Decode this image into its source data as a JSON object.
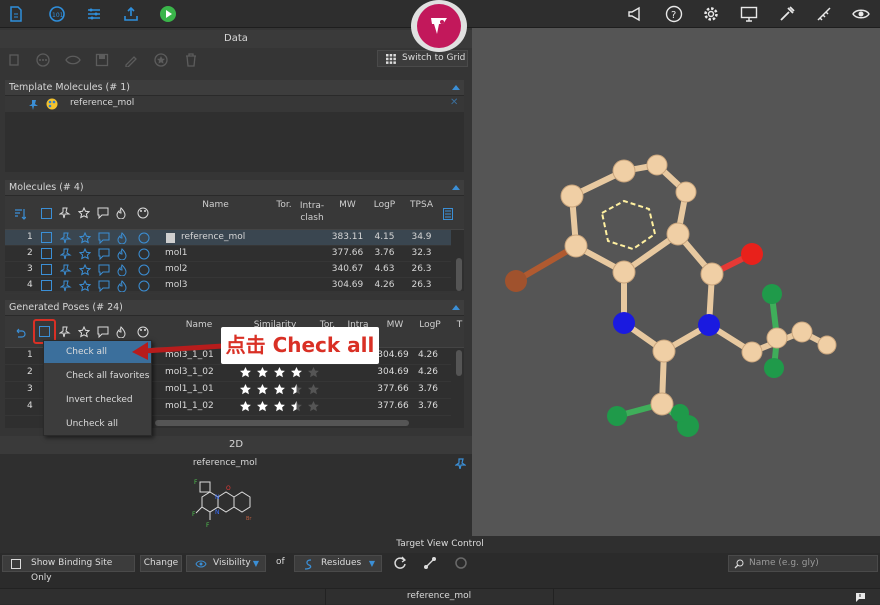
{
  "data_header": "Data",
  "switch_to_grid": "Switch to Grid",
  "template": {
    "title": "Template Molecules  (# 1)",
    "item": "reference_mol"
  },
  "molecules": {
    "title": "Molecules  (# 4)",
    "columns": [
      "Name",
      "Tor.",
      "Intra-clash",
      "MW",
      "LogP",
      "TPSA"
    ],
    "rows": [
      {
        "idx": "1",
        "name": "reference_mol",
        "mw": "383.11",
        "logp": "4.15",
        "tpsa": "34.9"
      },
      {
        "idx": "2",
        "name": "mol1",
        "mw": "377.66",
        "logp": "3.76",
        "tpsa": "32.3"
      },
      {
        "idx": "3",
        "name": "mol2",
        "mw": "340.67",
        "logp": "4.63",
        "tpsa": "26.3"
      },
      {
        "idx": "4",
        "name": "mol3",
        "mw": "304.69",
        "logp": "4.26",
        "tpsa": "26.3"
      }
    ]
  },
  "poses": {
    "title": "Generated Poses  (# 24)",
    "columns": [
      "Name",
      "Similarity",
      "Tor.",
      "Intra",
      "MW",
      "LogP",
      "T"
    ],
    "rows": [
      {
        "idx": "1",
        "name": "mol3_1_01",
        "mw": "304.69",
        "logp": "4.26",
        "stars": 4
      },
      {
        "idx": "2",
        "name": "mol3_1_02",
        "mw": "304.69",
        "logp": "4.26",
        "stars": 4
      },
      {
        "idx": "3",
        "name": "mol1_1_01",
        "mw": "377.66",
        "logp": "3.76",
        "stars": 3.5
      },
      {
        "idx": "4",
        "name": "mol1_1_02",
        "mw": "377.66",
        "logp": "3.76",
        "stars": 3.5
      }
    ]
  },
  "context_menu": [
    "Check all",
    "Check all favorites",
    "Invert checked",
    "Uncheck all"
  ],
  "callout": "点击 Check all",
  "panel2d": {
    "header": "2D",
    "title": "reference_mol"
  },
  "target_view": {
    "header": "Target View Control",
    "show_binding": "Show Binding Site Only",
    "change": "Change",
    "visibility": "Visibility",
    "of": "of",
    "residues": "Residues",
    "search_placeholder": "Name (e.g. gly)"
  },
  "status": {
    "name": "reference_mol"
  },
  "colors": {
    "accent": "#3b8fd6",
    "logo": "#c2185b",
    "callout": "#d93025"
  }
}
